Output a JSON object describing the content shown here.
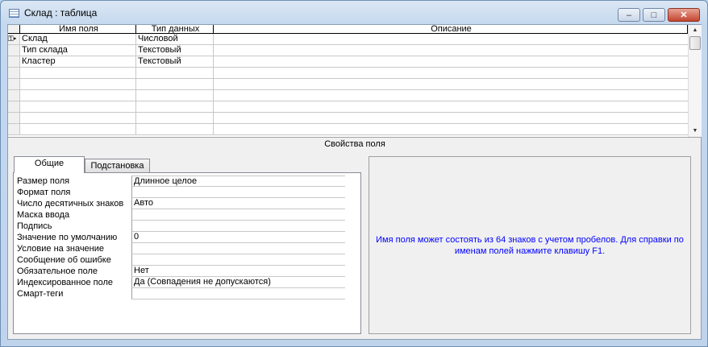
{
  "window": {
    "title": "Склад : таблица",
    "minimize": "–",
    "maximize": "□",
    "close": "✕"
  },
  "grid": {
    "headers": [
      "Имя поля",
      "Тип данных",
      "Описание"
    ],
    "rows": [
      {
        "key": true,
        "name": "Склад",
        "type": "Числовой",
        "desc": ""
      },
      {
        "name": "Тип склада",
        "type": "Текстовый",
        "desc": ""
      },
      {
        "name": "Кластер",
        "type": "Текстовый",
        "desc": ""
      },
      {
        "name": "",
        "type": "",
        "desc": ""
      },
      {
        "name": "",
        "type": "",
        "desc": ""
      },
      {
        "name": "",
        "type": "",
        "desc": ""
      },
      {
        "name": "",
        "type": "",
        "desc": ""
      },
      {
        "name": "",
        "type": "",
        "desc": ""
      },
      {
        "name": "",
        "type": "",
        "desc": ""
      }
    ]
  },
  "band": "Свойства поля",
  "tabs": [
    "Общие",
    "Подстановка"
  ],
  "properties": [
    [
      "Размер поля",
      "Длинное целое"
    ],
    [
      "Формат поля",
      ""
    ],
    [
      "Число десятичных знаков",
      "Авто"
    ],
    [
      "Маска ввода",
      ""
    ],
    [
      "Подпись",
      ""
    ],
    [
      "Значение по умолчанию",
      "0"
    ],
    [
      "Условие на значение",
      ""
    ],
    [
      "Сообщение об ошибке",
      ""
    ],
    [
      "Обязательное поле",
      "Нет"
    ],
    [
      "Индексированное поле",
      "Да (Совпадения не допускаются)"
    ],
    [
      "Смарт-теги",
      ""
    ]
  ],
  "help": "Имя поля может состоять из 64 знаков с учетом пробелов.  Для справки по именам полей нажмите клавишу F1.",
  "colors": {
    "help_text": "#0000ff"
  }
}
